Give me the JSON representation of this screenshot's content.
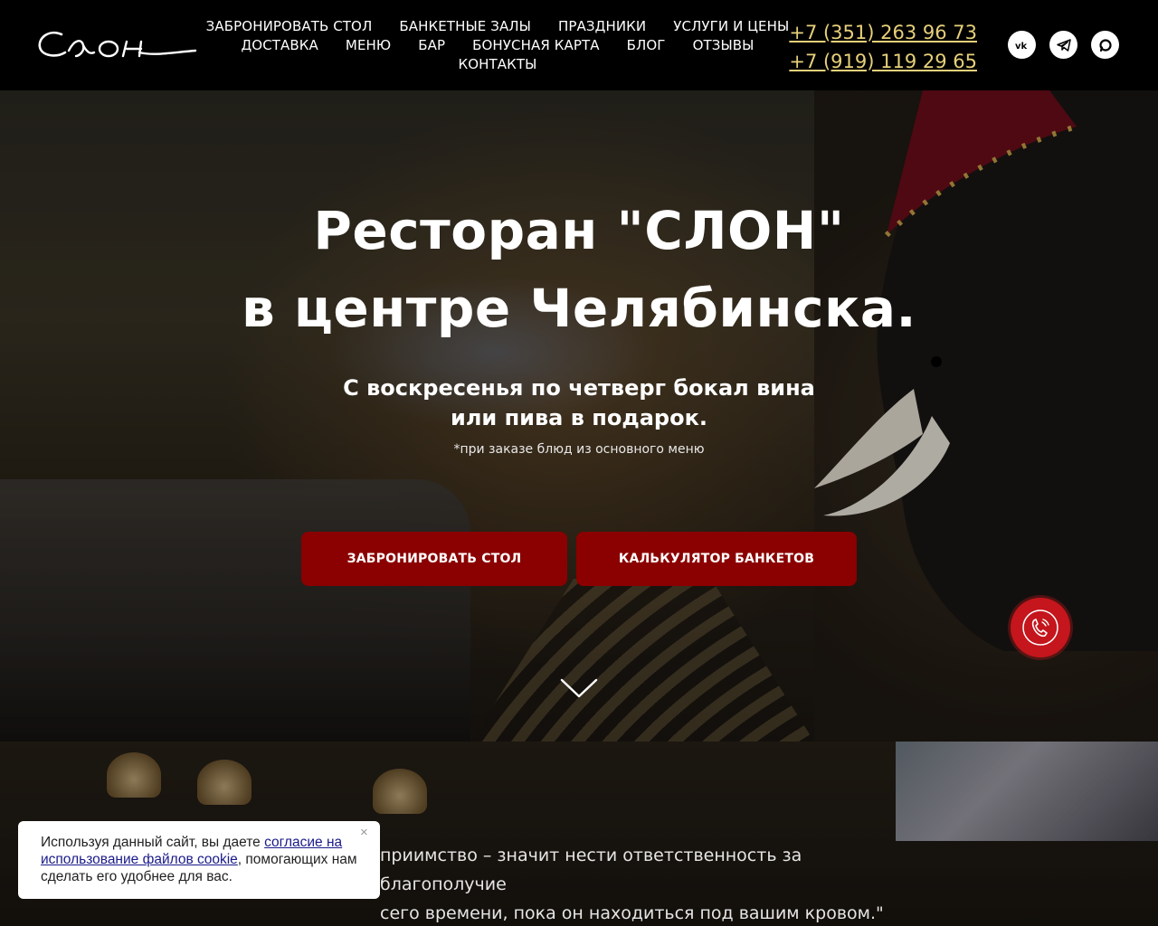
{
  "header": {
    "logo_text": "Слон",
    "nav_rows": [
      [
        "ЗАБРОНИРОВАТЬ СТОЛ",
        "БАНКЕТНЫЕ ЗАЛЫ",
        "ПРАЗДНИКИ",
        "УСЛУГИ И ЦЕНЫ"
      ],
      [
        "ДОСТАВКА",
        "МЕНЮ",
        "БАР",
        "БОНУСНАЯ КАРТА",
        "БЛОГ",
        "ОТЗЫВЫ"
      ],
      [
        "КОНТАКТЫ"
      ]
    ],
    "phones": [
      "+7 (351) 263 96 73",
      "+7 (919) 119 29 65"
    ],
    "socials": [
      "vk-icon",
      "telegram-icon",
      "max-icon"
    ]
  },
  "hero": {
    "title_line1": "Ресторан \"СЛОН\"",
    "title_line2": "в центре Челябинска.",
    "sub_line1": "С воскресенья по четверг бокал вина",
    "sub_line2": "или пива в подарок.",
    "note": "*при заказе блюд из основного меню",
    "btn_book": "ЗАБРОНИРОВАТЬ СТОЛ",
    "btn_calc": "КАЛЬКУЛЯТОР БАНКЕТОВ"
  },
  "section2": {
    "quote_line1": "приимство – значит нести ответственность за благополучие",
    "quote_line2": "сего времени, пока он находиться под вашим кровом.\""
  },
  "cookie": {
    "text_before": "Используя данный сайт, вы даете ",
    "link_text": "согласие на использование файлов cookie",
    "text_after": ", помогающих нам сделать его удобнее для вас.",
    "close": "×"
  },
  "colors": {
    "accent_red": "#8b0000",
    "phone_gold": "#e7d07a",
    "call_red": "#c4161c"
  }
}
